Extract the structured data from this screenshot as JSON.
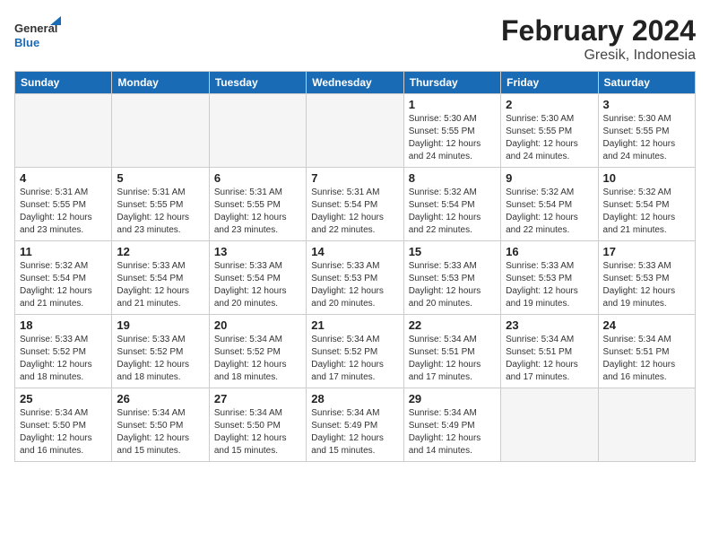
{
  "header": {
    "logo_general": "General",
    "logo_blue": "Blue",
    "title": "February 2024",
    "subtitle": "Gresik, Indonesia"
  },
  "calendar": {
    "days_of_week": [
      "Sunday",
      "Monday",
      "Tuesday",
      "Wednesday",
      "Thursday",
      "Friday",
      "Saturday"
    ],
    "weeks": [
      [
        {
          "day": "",
          "info": ""
        },
        {
          "day": "",
          "info": ""
        },
        {
          "day": "",
          "info": ""
        },
        {
          "day": "",
          "info": ""
        },
        {
          "day": "1",
          "info": "Sunrise: 5:30 AM\nSunset: 5:55 PM\nDaylight: 12 hours and 24 minutes."
        },
        {
          "day": "2",
          "info": "Sunrise: 5:30 AM\nSunset: 5:55 PM\nDaylight: 12 hours and 24 minutes."
        },
        {
          "day": "3",
          "info": "Sunrise: 5:30 AM\nSunset: 5:55 PM\nDaylight: 12 hours and 24 minutes."
        }
      ],
      [
        {
          "day": "4",
          "info": "Sunrise: 5:31 AM\nSunset: 5:55 PM\nDaylight: 12 hours and 23 minutes."
        },
        {
          "day": "5",
          "info": "Sunrise: 5:31 AM\nSunset: 5:55 PM\nDaylight: 12 hours and 23 minutes."
        },
        {
          "day": "6",
          "info": "Sunrise: 5:31 AM\nSunset: 5:55 PM\nDaylight: 12 hours and 23 minutes."
        },
        {
          "day": "7",
          "info": "Sunrise: 5:31 AM\nSunset: 5:54 PM\nDaylight: 12 hours and 22 minutes."
        },
        {
          "day": "8",
          "info": "Sunrise: 5:32 AM\nSunset: 5:54 PM\nDaylight: 12 hours and 22 minutes."
        },
        {
          "day": "9",
          "info": "Sunrise: 5:32 AM\nSunset: 5:54 PM\nDaylight: 12 hours and 22 minutes."
        },
        {
          "day": "10",
          "info": "Sunrise: 5:32 AM\nSunset: 5:54 PM\nDaylight: 12 hours and 21 minutes."
        }
      ],
      [
        {
          "day": "11",
          "info": "Sunrise: 5:32 AM\nSunset: 5:54 PM\nDaylight: 12 hours and 21 minutes."
        },
        {
          "day": "12",
          "info": "Sunrise: 5:33 AM\nSunset: 5:54 PM\nDaylight: 12 hours and 21 minutes."
        },
        {
          "day": "13",
          "info": "Sunrise: 5:33 AM\nSunset: 5:54 PM\nDaylight: 12 hours and 20 minutes."
        },
        {
          "day": "14",
          "info": "Sunrise: 5:33 AM\nSunset: 5:53 PM\nDaylight: 12 hours and 20 minutes."
        },
        {
          "day": "15",
          "info": "Sunrise: 5:33 AM\nSunset: 5:53 PM\nDaylight: 12 hours and 20 minutes."
        },
        {
          "day": "16",
          "info": "Sunrise: 5:33 AM\nSunset: 5:53 PM\nDaylight: 12 hours and 19 minutes."
        },
        {
          "day": "17",
          "info": "Sunrise: 5:33 AM\nSunset: 5:53 PM\nDaylight: 12 hours and 19 minutes."
        }
      ],
      [
        {
          "day": "18",
          "info": "Sunrise: 5:33 AM\nSunset: 5:52 PM\nDaylight: 12 hours and 18 minutes."
        },
        {
          "day": "19",
          "info": "Sunrise: 5:33 AM\nSunset: 5:52 PM\nDaylight: 12 hours and 18 minutes."
        },
        {
          "day": "20",
          "info": "Sunrise: 5:34 AM\nSunset: 5:52 PM\nDaylight: 12 hours and 18 minutes."
        },
        {
          "day": "21",
          "info": "Sunrise: 5:34 AM\nSunset: 5:52 PM\nDaylight: 12 hours and 17 minutes."
        },
        {
          "day": "22",
          "info": "Sunrise: 5:34 AM\nSunset: 5:51 PM\nDaylight: 12 hours and 17 minutes."
        },
        {
          "day": "23",
          "info": "Sunrise: 5:34 AM\nSunset: 5:51 PM\nDaylight: 12 hours and 17 minutes."
        },
        {
          "day": "24",
          "info": "Sunrise: 5:34 AM\nSunset: 5:51 PM\nDaylight: 12 hours and 16 minutes."
        }
      ],
      [
        {
          "day": "25",
          "info": "Sunrise: 5:34 AM\nSunset: 5:50 PM\nDaylight: 12 hours and 16 minutes."
        },
        {
          "day": "26",
          "info": "Sunrise: 5:34 AM\nSunset: 5:50 PM\nDaylight: 12 hours and 15 minutes."
        },
        {
          "day": "27",
          "info": "Sunrise: 5:34 AM\nSunset: 5:50 PM\nDaylight: 12 hours and 15 minutes."
        },
        {
          "day": "28",
          "info": "Sunrise: 5:34 AM\nSunset: 5:49 PM\nDaylight: 12 hours and 15 minutes."
        },
        {
          "day": "29",
          "info": "Sunrise: 5:34 AM\nSunset: 5:49 PM\nDaylight: 12 hours and 14 minutes."
        },
        {
          "day": "",
          "info": ""
        },
        {
          "day": "",
          "info": ""
        }
      ]
    ]
  }
}
